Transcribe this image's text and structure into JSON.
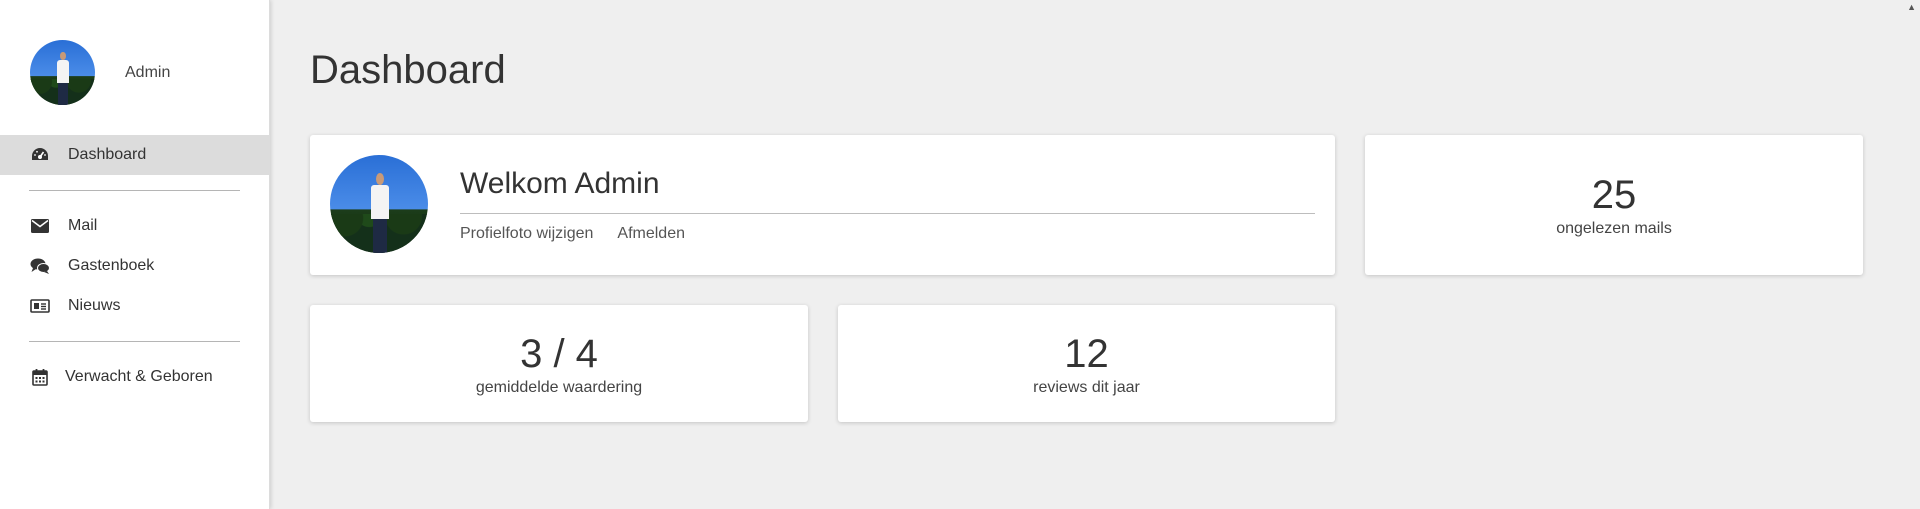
{
  "sidebar": {
    "profile_name": "Admin",
    "items": [
      {
        "label": "Dashboard",
        "icon": "dashboard-gauge-icon",
        "active": true
      },
      {
        "label": "Mail",
        "icon": "envelope-icon"
      },
      {
        "label": "Gastenboek",
        "icon": "comments-icon"
      },
      {
        "label": "Nieuws",
        "icon": "newspaper-icon"
      },
      {
        "label": "Verwacht & Geboren",
        "icon": "calendar-icon"
      }
    ]
  },
  "main": {
    "title": "Dashboard",
    "welcome": {
      "title": "Welkom Admin",
      "links": [
        "Profielfoto wijzigen",
        "Afmelden"
      ]
    },
    "stats": {
      "mails": {
        "value": "25",
        "label": "ongelezen mails"
      },
      "rating": {
        "value": "3 / 4",
        "label": "gemiddelde waardering"
      },
      "reviews": {
        "value": "12",
        "label": "reviews dit jaar"
      }
    }
  },
  "colors": {
    "background": "#efefef",
    "sidebar_bg": "#ffffff",
    "active_item_bg": "#dcdcdc",
    "card_bg": "#ffffff",
    "text": "#333333"
  }
}
